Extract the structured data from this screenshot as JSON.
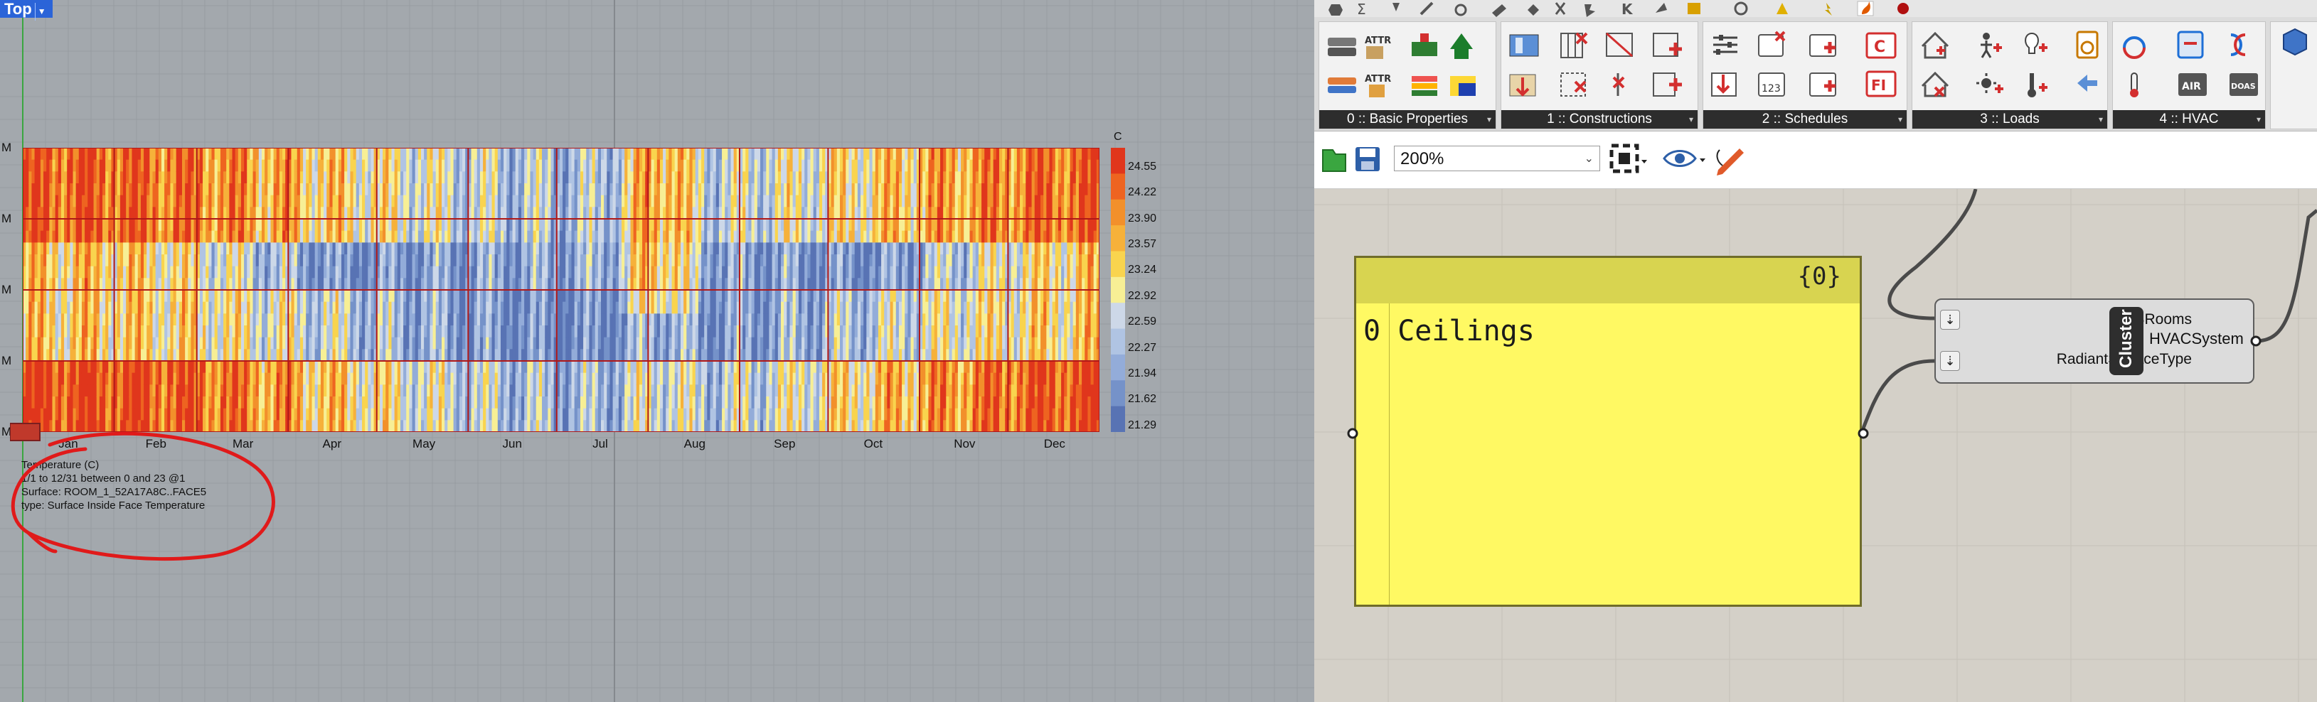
{
  "viewport": {
    "tab_label": "Top",
    "months": [
      "Jan",
      "Feb",
      "Mar",
      "Apr",
      "May",
      "Jun",
      "Jul",
      "Aug",
      "Sep",
      "Oct",
      "Nov",
      "Dec"
    ],
    "hour_marks": [
      "M",
      "M",
      "M",
      "M",
      "M"
    ],
    "legend": {
      "unit": "C",
      "values": [
        "24.55",
        "24.22",
        "23.90",
        "23.57",
        "23.24",
        "22.92",
        "22.59",
        "22.27",
        "21.94",
        "21.62",
        "21.29"
      ],
      "colors": [
        "#e0361c",
        "#ee6420",
        "#f2902b",
        "#f6b13a",
        "#f9d44e",
        "#f7ef95",
        "#cdd8e8",
        "#b0c4e3",
        "#93acd9",
        "#7592c9",
        "#5873b4"
      ]
    },
    "info": {
      "line1": "Temperature (C)",
      "line2": "1/1 to 12/31 between 0 and 23 @1",
      "line3": "Surface: ROOM_1_52A17A8C..FACE5",
      "line4": "type: Surface Inside Face Temperature"
    },
    "annotation_color": "#e01a1a"
  },
  "chart_data": {
    "type": "heatmap",
    "title": "Temperature (C)",
    "x_categories": [
      "Jan",
      "Feb",
      "Mar",
      "Apr",
      "May",
      "Jun",
      "Jul",
      "Aug",
      "Sep",
      "Oct",
      "Nov",
      "Dec"
    ],
    "y_axis": "hour of day (0 to 23)",
    "legend_title": "C",
    "legend_min": 21.29,
    "legend_max": 24.55,
    "legend_ticks": [
      24.55,
      24.22,
      23.9,
      23.57,
      23.24,
      22.92,
      22.59,
      22.27,
      21.94,
      21.62,
      21.29
    ]
  },
  "grasshopper": {
    "ribbon_panels": [
      {
        "label": "0 :: Basic Properties"
      },
      {
        "label": "1 :: Constructions"
      },
      {
        "label": "2 :: Schedules"
      },
      {
        "label": "3 :: Loads"
      },
      {
        "label": "4 :: HVAC"
      }
    ],
    "attr_label": "ATTR",
    "zoom": "200%",
    "panel_node": {
      "index_header": "{0}",
      "row_index": "0",
      "row_value": "Ceilings"
    },
    "cluster": {
      "inputs": [
        "HBRooms",
        "RadiantSurfaceType"
      ],
      "center_label": "Cluster",
      "output": "HVACSystem"
    }
  }
}
